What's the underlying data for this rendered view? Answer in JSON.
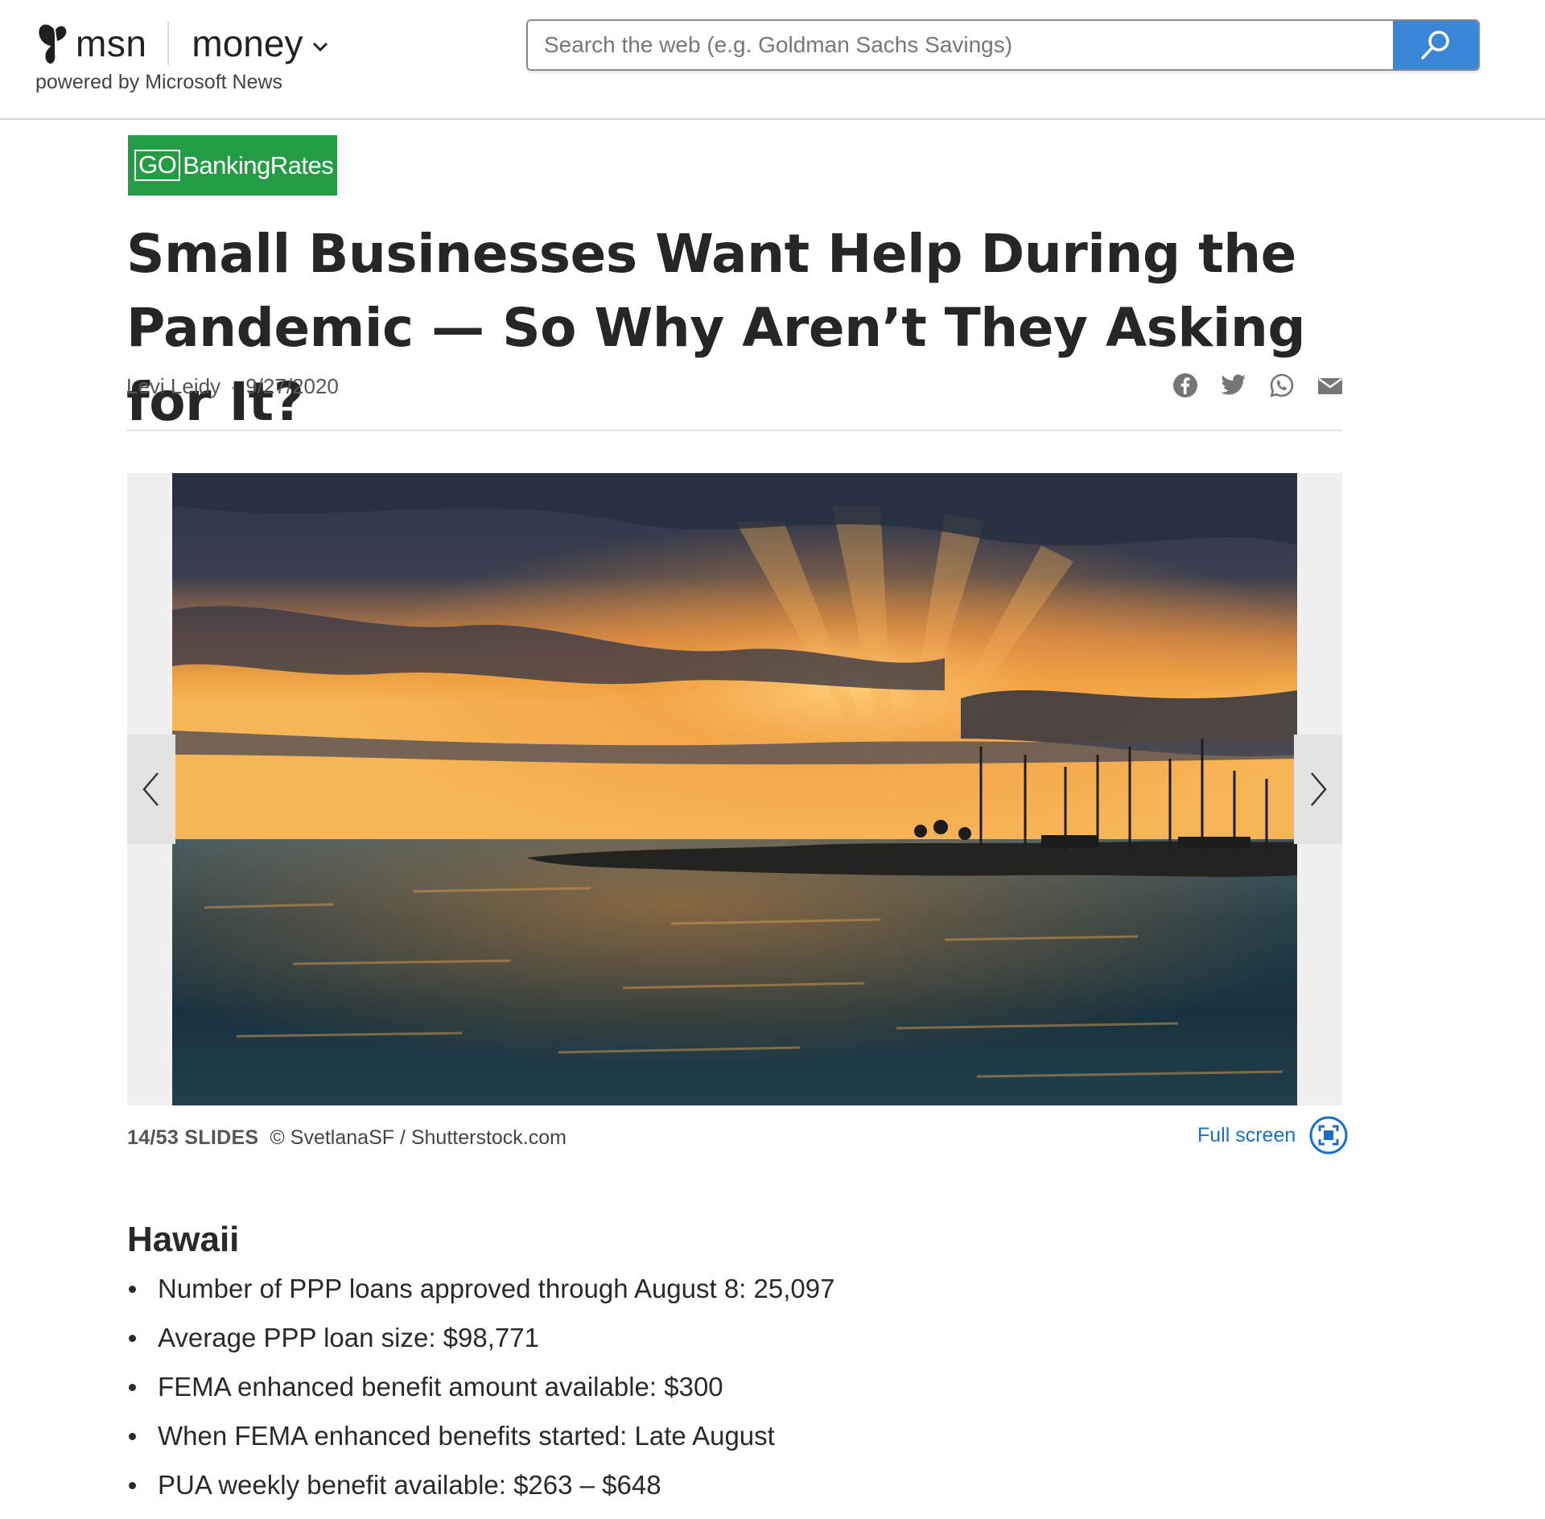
{
  "header": {
    "brand": "msn",
    "section": "money",
    "powered_by": "powered by Microsoft News",
    "search": {
      "placeholder": "Search the web (e.g. Goldman Sachs Savings)",
      "value": ""
    }
  },
  "article": {
    "source_logo": {
      "go": "GO",
      "rest": "BankingRates",
      "color": "#239c45"
    },
    "title": "Small Businesses Want Help During the Pandemic — So Why Aren’t They Asking for It?",
    "author": "Levi Leidy",
    "separator": "·",
    "date": "9/27/2020",
    "share_icons": [
      "facebook-icon",
      "twitter-icon",
      "whatsapp-icon",
      "mail-icon"
    ]
  },
  "slideshow": {
    "counter": "14/53 SLIDES",
    "credit": "© SvetlanaSF / Shutterstock.com",
    "fullscreen_label": "Full screen"
  },
  "content": {
    "section_title": "Hawaii",
    "facts": [
      "Number of PPP loans approved through August 8: 25,097",
      "Average PPP loan size: $98,771",
      "FEMA enhanced benefit amount available: $300",
      "When FEMA enhanced benefits started: Late August",
      "PUA weekly benefit available: $263 – $648"
    ]
  },
  "colors": {
    "accent": "#3a87d8",
    "link": "#1a6fc9"
  }
}
